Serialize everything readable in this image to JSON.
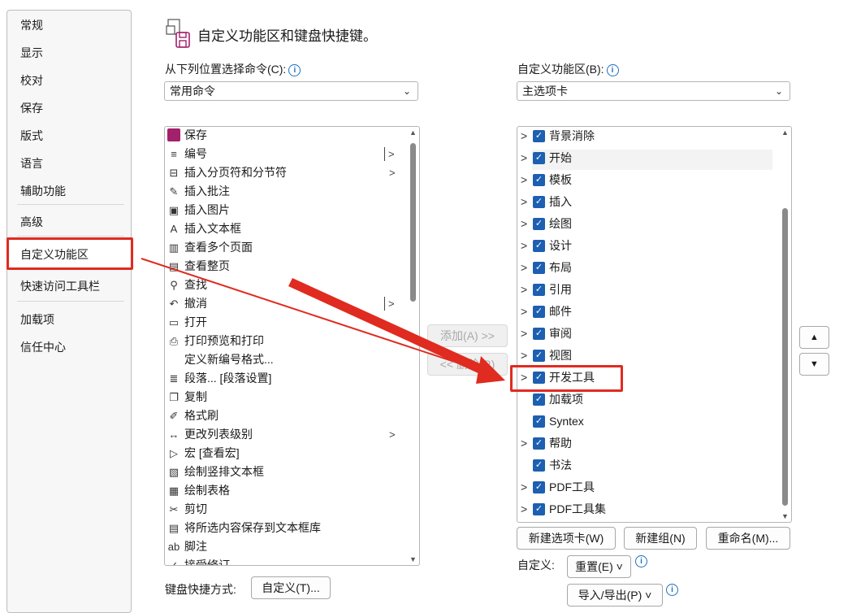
{
  "nav": {
    "items": [
      "常规",
      "显示",
      "校对",
      "保存",
      "版式",
      "语言",
      "辅助功能",
      "高级",
      "自定义功能区",
      "快速访问工具栏",
      "加载项",
      "信任中心"
    ],
    "selected": "自定义功能区"
  },
  "header": {
    "title": "自定义功能区和键盘快捷键。"
  },
  "left": {
    "label": "从下列位置选择命令(C):",
    "dropdown_value": "常用命令",
    "commands": [
      {
        "label": "保存",
        "icon": "save-icon"
      },
      {
        "label": "编号",
        "icon": "numbering-icon",
        "sub": "|>"
      },
      {
        "label": "插入分页符和分节符",
        "icon": "page-break-icon",
        "sub": ">"
      },
      {
        "label": "插入批注",
        "icon": "comment-icon"
      },
      {
        "label": "插入图片",
        "icon": "picture-icon"
      },
      {
        "label": "插入文本框",
        "icon": "textbox-icon"
      },
      {
        "label": "查看多个页面",
        "icon": "multiple-pages-icon"
      },
      {
        "label": "查看整页",
        "icon": "one-page-icon"
      },
      {
        "label": "查找",
        "icon": "search-icon"
      },
      {
        "label": "撤消",
        "icon": "undo-icon",
        "sub": "|>"
      },
      {
        "label": "打开",
        "icon": "open-folder-icon"
      },
      {
        "label": "打印预览和打印",
        "icon": "print-preview-icon"
      },
      {
        "label": "定义新编号格式...",
        "icon": ""
      },
      {
        "label": "段落... [段落设置]",
        "icon": "paragraph-icon"
      },
      {
        "label": "复制",
        "icon": "copy-icon"
      },
      {
        "label": "格式刷",
        "icon": "format-painter-icon"
      },
      {
        "label": "更改列表级别",
        "icon": "list-level-icon",
        "sub": ">"
      },
      {
        "label": "宏 [查看宏]",
        "icon": "macro-icon"
      },
      {
        "label": "绘制竖排文本框",
        "icon": "vertical-textbox-icon"
      },
      {
        "label": "绘制表格",
        "icon": "draw-table-icon"
      },
      {
        "label": "剪切",
        "icon": "cut-icon"
      },
      {
        "label": "将所选内容保存到文本框库",
        "icon": "save-selection-icon"
      },
      {
        "label": "脚注",
        "icon": "footnote-icon"
      },
      {
        "label": "接受修订",
        "icon": "accept-icon"
      }
    ],
    "icons_text": {
      "footnote": "ab¹"
    }
  },
  "middle": {
    "add_label": "添加(A) >>",
    "remove_label": "<< 删除(R)"
  },
  "right": {
    "label": "自定义功能区(B):",
    "dropdown_value": "主选项卡",
    "tabs": [
      {
        "label": "背景消除",
        "expander": true
      },
      {
        "label": "开始",
        "expander": true
      },
      {
        "label": "模板",
        "expander": true
      },
      {
        "label": "插入",
        "expander": true
      },
      {
        "label": "绘图",
        "expander": true
      },
      {
        "label": "设计",
        "expander": true
      },
      {
        "label": "布局",
        "expander": true
      },
      {
        "label": "引用",
        "expander": true
      },
      {
        "label": "邮件",
        "expander": true
      },
      {
        "label": "审阅",
        "expander": true
      },
      {
        "label": "视图",
        "expander": true
      },
      {
        "label": "开发工具",
        "expander": true
      },
      {
        "label": "加载项",
        "expander": false
      },
      {
        "label": "Syntex",
        "expander": false
      },
      {
        "label": "帮助",
        "expander": true
      },
      {
        "label": "书法",
        "expander": false
      },
      {
        "label": "PDF工具",
        "expander": true
      },
      {
        "label": "PDF工具集",
        "expander": true
      }
    ],
    "highlighted_tab": "开发工具",
    "buttons": {
      "new_tab": "新建选项卡(W)",
      "new_group": "新建组(N)",
      "rename": "重命名(M)..."
    },
    "customize_label": "自定义:",
    "reset_label": "重置(E) ˅",
    "import_export_label": "导入/导出(P) ˅"
  },
  "keyboard": {
    "label": "键盘快捷方式:",
    "button": "自定义(T)..."
  },
  "colors": {
    "highlight": "#e02b20",
    "checkbox": "#1d5fb0",
    "info": "#1f6fbf"
  }
}
